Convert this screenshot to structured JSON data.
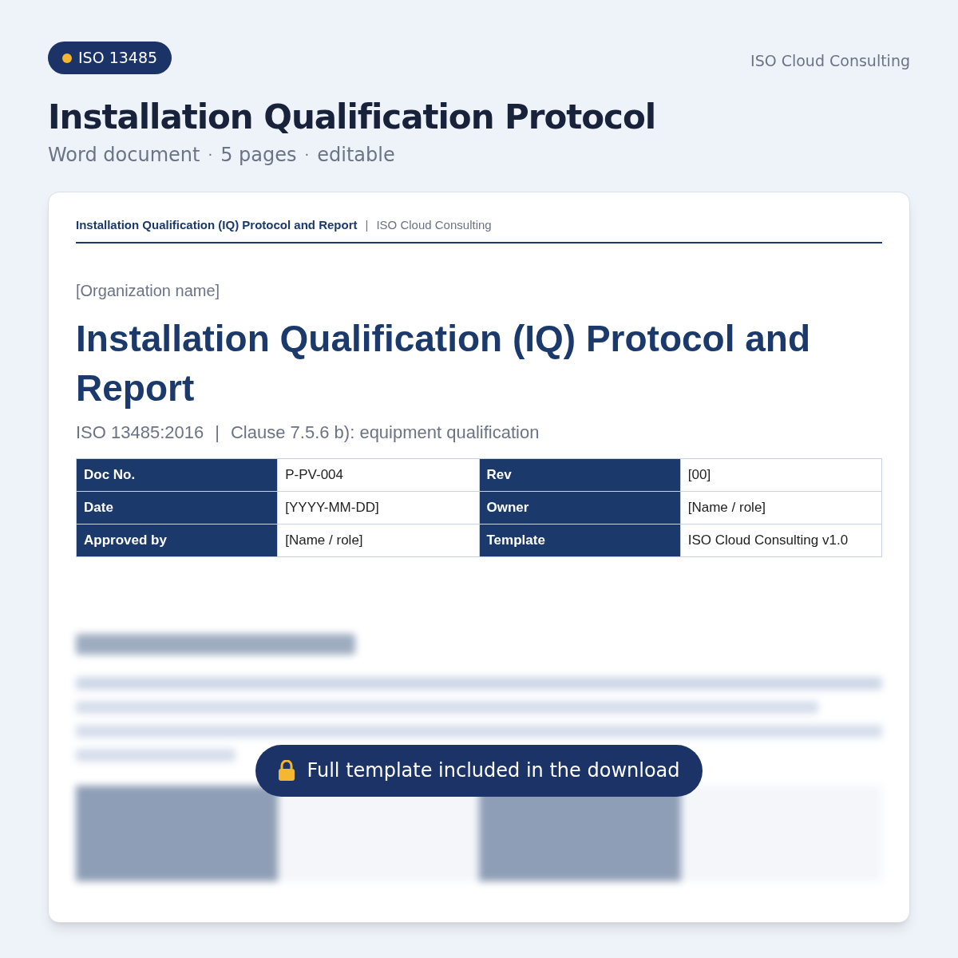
{
  "badge": {
    "label": "ISO 13485"
  },
  "brand": "ISO Cloud Consulting",
  "title": "Installation Qualification Protocol",
  "meta": {
    "items": [
      "Word document",
      "5 pages",
      "editable"
    ],
    "separator": "·"
  },
  "document": {
    "header": {
      "title": "Installation Qualification (IQ) Protocol and Report",
      "separator": "|",
      "brand": "ISO Cloud Consulting"
    },
    "organization": "[Organization name]",
    "title": "Installation Qualification (IQ) Protocol and Report",
    "subtitle": {
      "parts": [
        "ISO 13485:2016",
        "Clause 7.5.6 b): equipment qualification"
      ],
      "separator": "|"
    },
    "info_rows": [
      [
        {
          "label": "Doc No.",
          "value": "P-PV-004"
        },
        {
          "label": "Rev",
          "value": "[00]"
        }
      ],
      [
        {
          "label": "Date",
          "value": "[YYYY-MM-DD]"
        },
        {
          "label": "Owner",
          "value": "[Name / role]"
        }
      ],
      [
        {
          "label": "Approved by",
          "value": "[Name / role]"
        },
        {
          "label": "Template",
          "value": "ISO Cloud Consulting v1.0"
        }
      ]
    ]
  },
  "lock_banner": {
    "label": "Full template included in the download"
  }
}
